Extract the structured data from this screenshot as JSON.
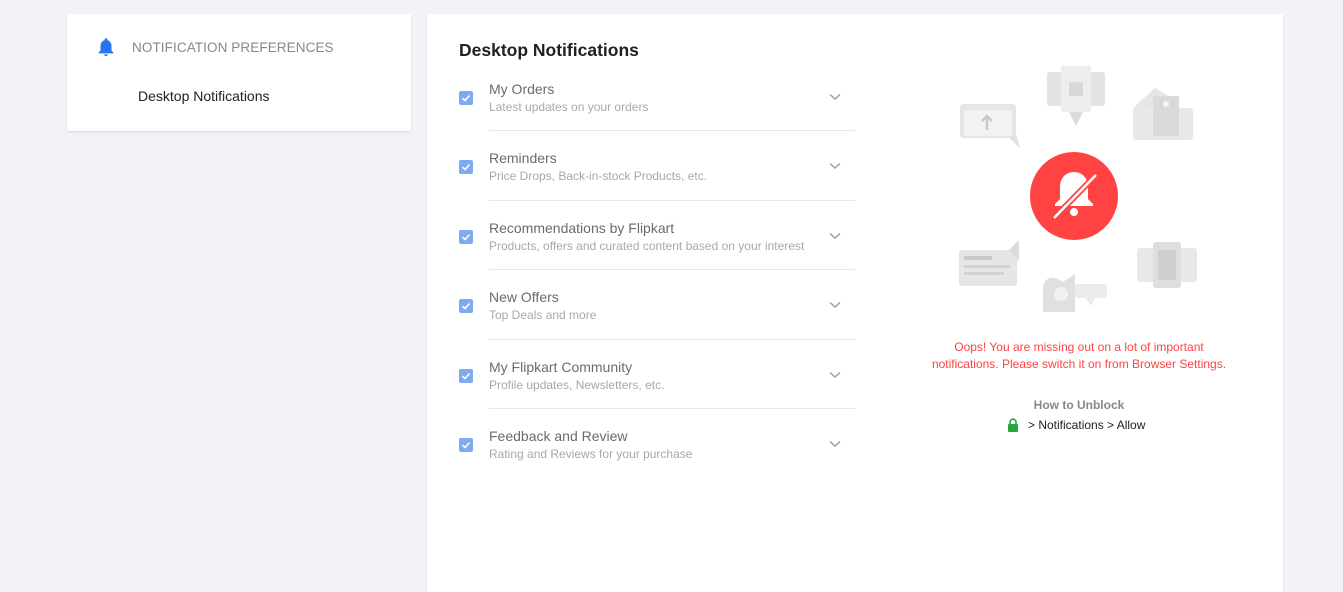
{
  "sidebar": {
    "icon": "bell-icon",
    "title": "NOTIFICATION PREFERENCES",
    "link": "Desktop Notifications"
  },
  "main": {
    "title": "Desktop Notifications",
    "preferences": [
      {
        "title": "My Orders",
        "subtitle": "Latest updates on your orders",
        "checked": true
      },
      {
        "title": "Reminders",
        "subtitle": "Price Drops, Back-in-stock Products, etc.",
        "checked": true
      },
      {
        "title": "Recommendations by Flipkart",
        "subtitle": "Products, offers and curated content based on your interest",
        "checked": true
      },
      {
        "title": "New Offers",
        "subtitle": "Top Deals and more",
        "checked": true
      },
      {
        "title": "My Flipkart Community",
        "subtitle": "Profile updates, Newsletters, etc.",
        "checked": true
      },
      {
        "title": "Feedback and Review",
        "subtitle": "Rating and Reviews for your purchase",
        "checked": true
      }
    ],
    "warning_line1": "Oops! You are missing out on a lot of important",
    "warning_line2": "notifications. Please switch it on from Browser Settings.",
    "how_title": "How to Unblock",
    "how_path": "> Notifications > Allow"
  },
  "colors": {
    "accent": "#2874f0",
    "checkbox": "#7eaaf0",
    "alert": "#ff4343",
    "lock": "#26a541"
  }
}
